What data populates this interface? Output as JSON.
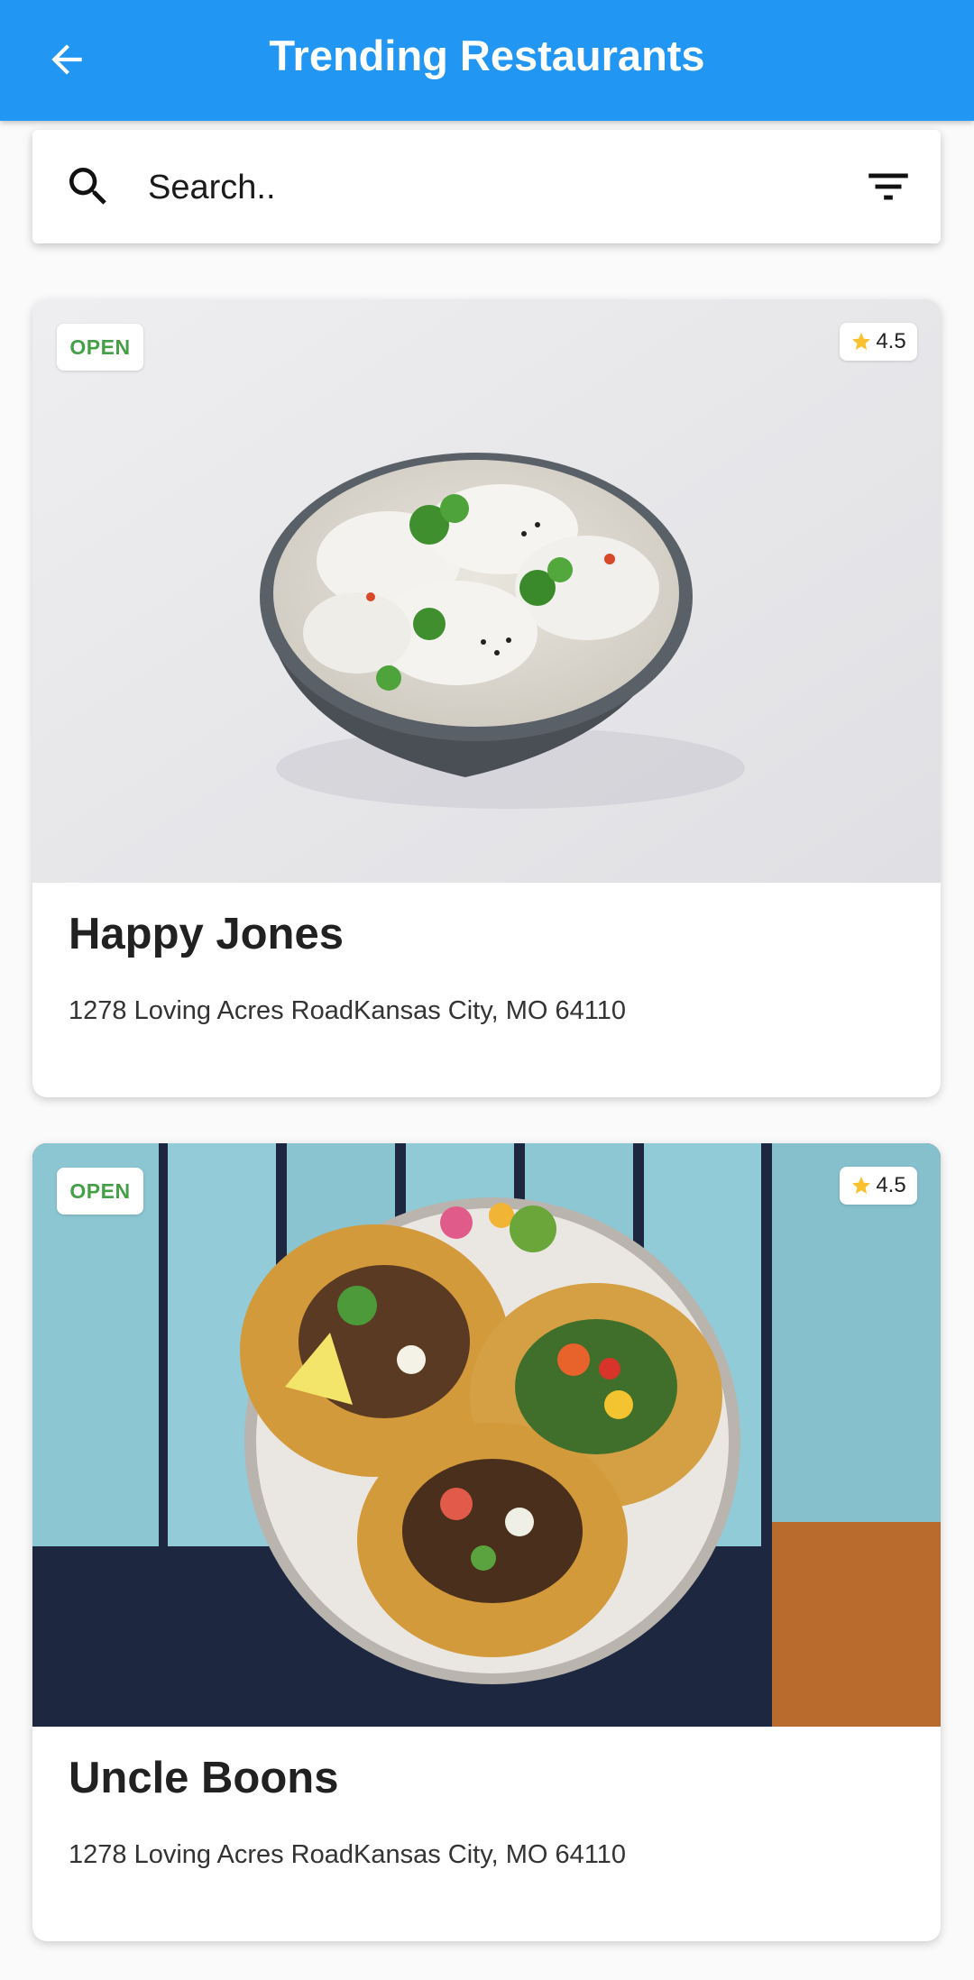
{
  "app_bar": {
    "title": "Trending Restaurants",
    "back_icon": "arrow-back-icon",
    "background": "#2196f3"
  },
  "search": {
    "placeholder": "Search..",
    "value": "",
    "search_icon": "search-icon",
    "filter_icon": "filter-icon"
  },
  "restaurants": [
    {
      "name": "Happy Jones",
      "address": "1278 Loving Acres RoadKansas City, MO 64110",
      "status": "OPEN",
      "rating": "4.5",
      "image": "dumplings-bowl-photo"
    },
    {
      "name": "Uncle Boons",
      "address": "1278 Loving Acres RoadKansas City, MO 64110",
      "status": "OPEN",
      "rating": "4.5",
      "image": "tacos-plate-photo"
    }
  ],
  "colors": {
    "open_status": "#43a047",
    "star": "#fbc02d"
  }
}
